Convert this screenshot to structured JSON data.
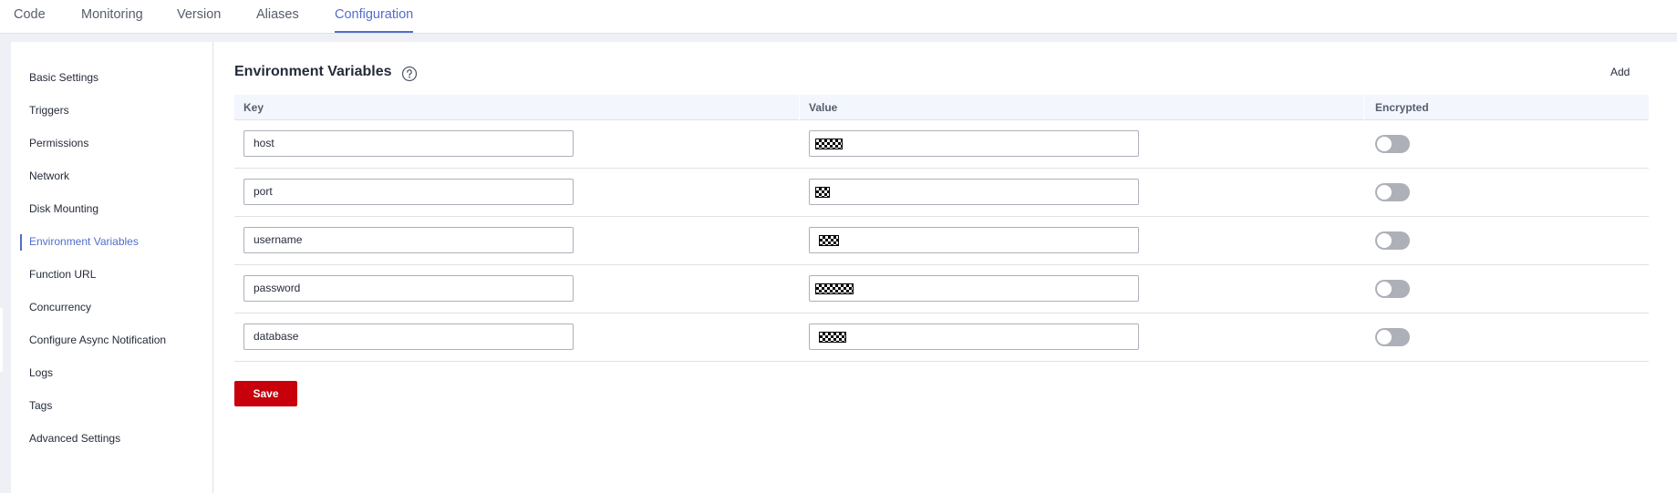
{
  "tabs": [
    {
      "label": "Code"
    },
    {
      "label": "Monitoring"
    },
    {
      "label": "Version"
    },
    {
      "label": "Aliases"
    },
    {
      "label": "Configuration",
      "active": true
    }
  ],
  "sidebar": {
    "items": [
      {
        "label": "Basic Settings"
      },
      {
        "label": "Triggers"
      },
      {
        "label": "Permissions"
      },
      {
        "label": "Network"
      },
      {
        "label": "Disk Mounting"
      },
      {
        "label": "Environment Variables",
        "active": true
      },
      {
        "label": "Function URL"
      },
      {
        "label": "Concurrency"
      },
      {
        "label": "Configure Async Notification"
      },
      {
        "label": "Logs"
      },
      {
        "label": "Tags"
      },
      {
        "label": "Advanced Settings"
      }
    ]
  },
  "main": {
    "title": "Environment Variables",
    "help_icon": "question-circle-icon",
    "add_label": "Add",
    "columns": [
      "Key",
      "Value",
      "Encrypted"
    ],
    "rows": [
      {
        "key": "host",
        "value_masked": true,
        "encrypted": false
      },
      {
        "key": "port",
        "value_masked": true,
        "encrypted": false
      },
      {
        "key": "username",
        "value_masked": true,
        "encrypted": false
      },
      {
        "key": "password",
        "value_masked": true,
        "encrypted": false
      },
      {
        "key": "database",
        "value_masked": true,
        "encrypted": false
      }
    ],
    "save_label": "Save"
  },
  "colors": {
    "accent": "#526ecc",
    "save_button": "#c7000b",
    "toggle_off": "#adb0b8"
  }
}
